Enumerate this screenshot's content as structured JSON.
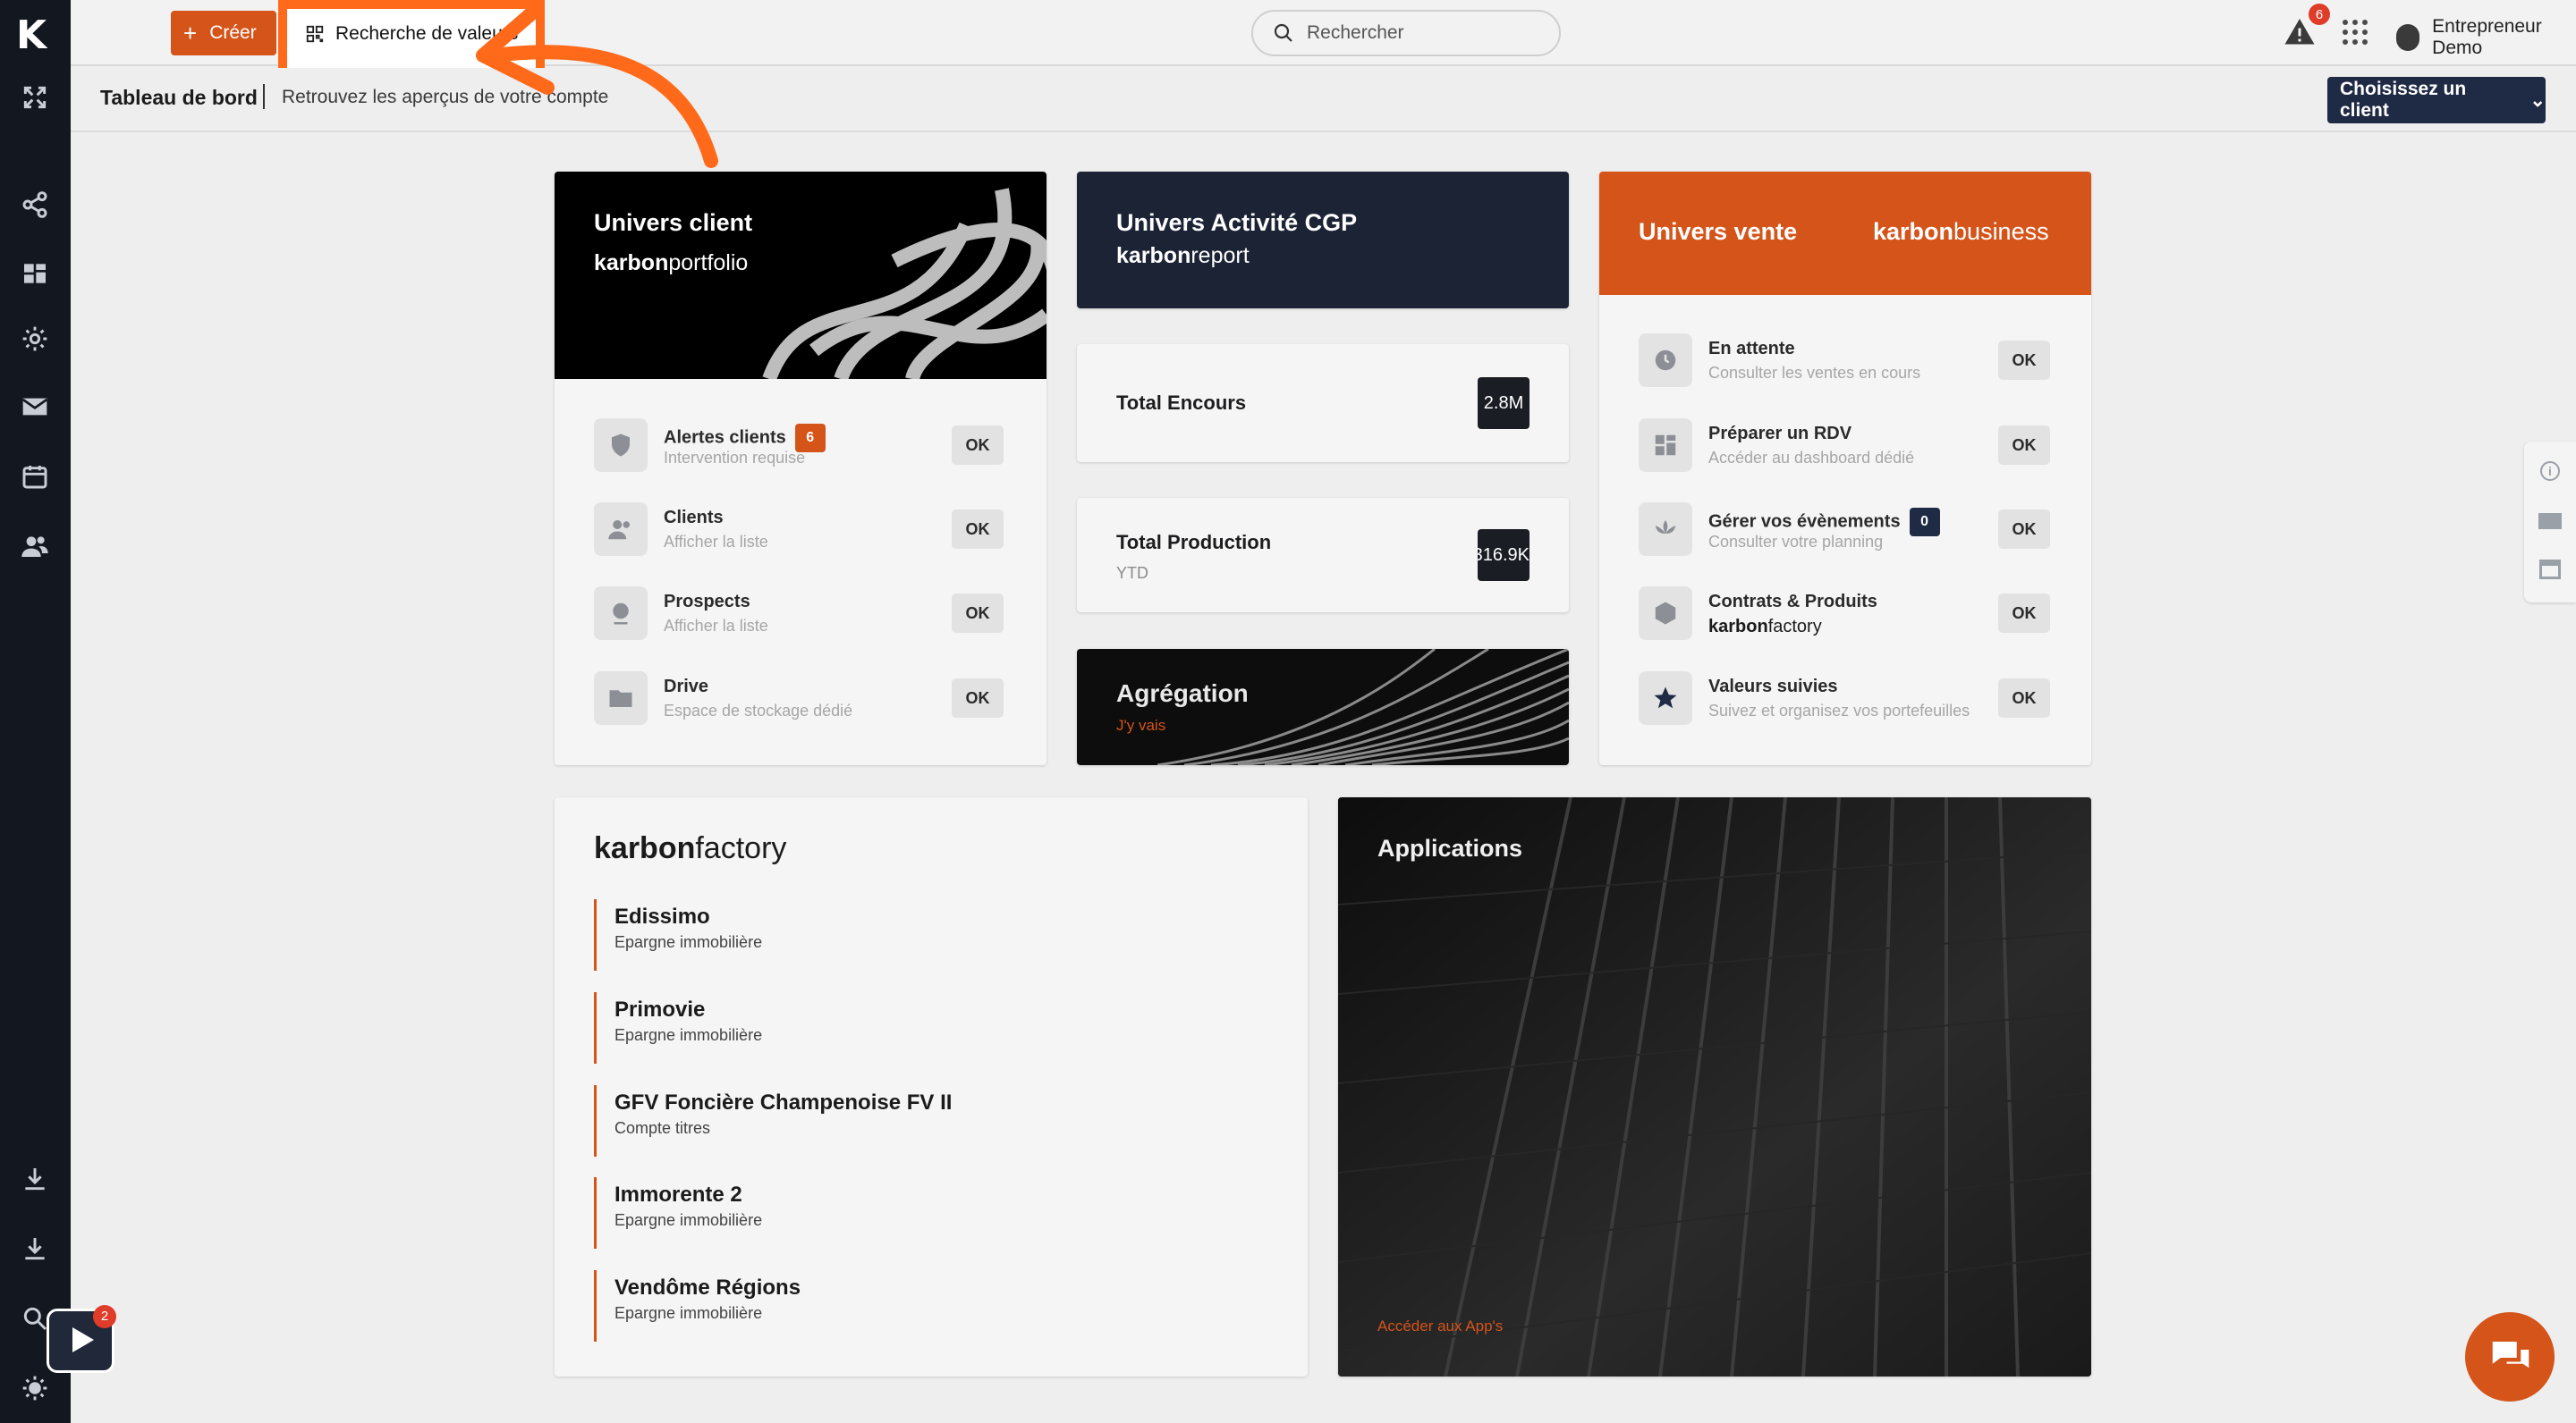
{
  "topbar": {
    "create_label": "Créer",
    "highlight_label": "Recherche de valeurs",
    "search_placeholder": "Rechercher",
    "alert_count": "6",
    "user_name": "Entrepreneur Demo"
  },
  "subheader": {
    "title": "Tableau de bord",
    "subtitle": "Retrouvez les aperçus de votre compte",
    "client_button": "Choisissez un client"
  },
  "univers_client": {
    "title": "Univers client",
    "brand_bold": "karbon",
    "brand_light": "portfolio",
    "rows": [
      {
        "title": "Alertes clients",
        "badge": "6",
        "sub": "Intervention requise",
        "ok": "OK"
      },
      {
        "title": "Clients",
        "sub": "Afficher la liste",
        "ok": "OK"
      },
      {
        "title": "Prospects",
        "sub": "Afficher la liste",
        "ok": "OK"
      },
      {
        "title": "Drive",
        "sub": "Espace de stockage dédié",
        "ok": "OK"
      }
    ]
  },
  "univers_cgp": {
    "title": "Univers Activité CGP",
    "brand_bold": "karbon",
    "brand_light": "report"
  },
  "total_encours": {
    "label": "Total Encours",
    "value": "2.8M"
  },
  "total_production": {
    "label": "Total Production",
    "sub": "YTD",
    "value": "316.9K"
  },
  "aggregation": {
    "title": "Agrégation",
    "link": "J'y vais"
  },
  "univers_vente": {
    "title": "Univers vente",
    "brand_bold": "karbon",
    "brand_light": "business",
    "rows": [
      {
        "title": "En attente",
        "sub": "Consulter les ventes en cours",
        "ok": "OK"
      },
      {
        "title": "Préparer un RDV",
        "sub": "Accéder au dashboard dédié",
        "ok": "OK"
      },
      {
        "title": "Gérer vos évènements",
        "badge": "0",
        "sub": "Consulter votre planning",
        "ok": "OK"
      },
      {
        "title": "Contrats & Produits",
        "brand_bold": "karbon",
        "brand_light": "factory",
        "ok": "OK"
      },
      {
        "title": "Valeurs suivies",
        "sub": "Suivez et organisez vos portefeuilles",
        "ok": "OK"
      }
    ]
  },
  "factory": {
    "brand_bold": "karbon",
    "brand_light": "factory",
    "items": [
      {
        "name": "Edissimo",
        "sub": "Epargne immobilière"
      },
      {
        "name": "Primovie",
        "sub": "Epargne immobilière"
      },
      {
        "name": "GFV Foncière Champenoise FV II",
        "sub": "Compte titres"
      },
      {
        "name": "Immorente 2",
        "sub": "Epargne immobilière"
      },
      {
        "name": "Vendôme Régions",
        "sub": "Epargne immobilière"
      }
    ]
  },
  "applications": {
    "title": "Applications",
    "link": "Accéder aux App's"
  },
  "video_badge": "2",
  "colors": {
    "accent": "#d4541a",
    "navy": "#1f2a44",
    "sidebar": "#131720",
    "highlight": "#ff6a1a"
  }
}
